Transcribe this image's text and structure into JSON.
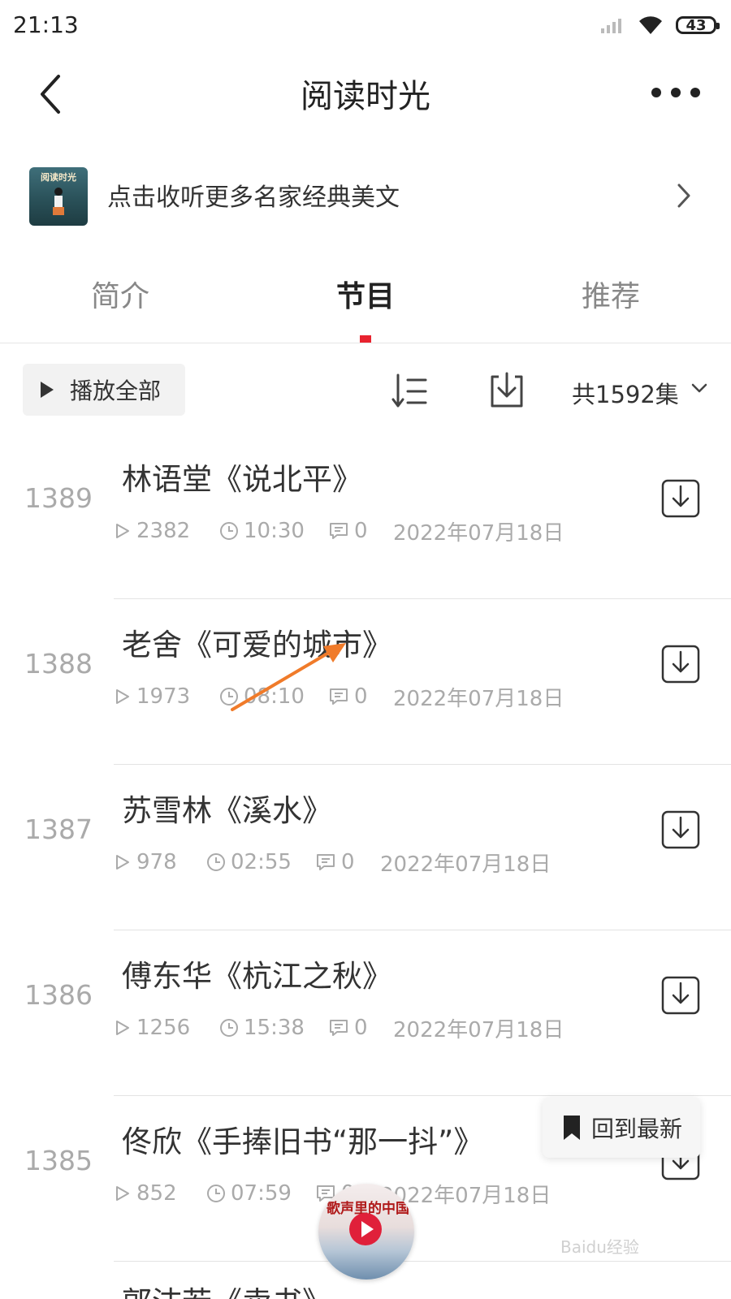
{
  "status_bar": {
    "time": "21:13",
    "battery": "43"
  },
  "header": {
    "title": "阅读时光"
  },
  "banner": {
    "cover_text": "阅读时光",
    "text": "点击收听更多名家经典美文"
  },
  "tabs": [
    {
      "label": "简介"
    },
    {
      "label": "节目"
    },
    {
      "label": "推荐"
    }
  ],
  "toolbar": {
    "play_all": "播放全部",
    "total_count": "共1592集"
  },
  "episodes": [
    {
      "num": "1389",
      "title": "林语堂《说北平》",
      "plays": "2382",
      "duration": "10:30",
      "comments": "0",
      "date": "2022年07月18日"
    },
    {
      "num": "1388",
      "title": "老舍《可爱的城市》",
      "plays": "1973",
      "duration": "08:10",
      "comments": "0",
      "date": "2022年07月18日"
    },
    {
      "num": "1387",
      "title": "苏雪林《溪水》",
      "plays": "978",
      "duration": "02:55",
      "comments": "0",
      "date": "2022年07月18日"
    },
    {
      "num": "1386",
      "title": "傅东华《杭江之秋》",
      "plays": "1256",
      "duration": "15:38",
      "comments": "0",
      "date": "2022年07月18日"
    },
    {
      "num": "1385",
      "title": "佟欣《手捧旧书“那一抖”》",
      "plays": "852",
      "duration": "07:59",
      "comments": "0",
      "date": "2022年07月18日"
    },
    {
      "num": "",
      "title": "郭沫若《卖书》",
      "plays": "",
      "duration": "",
      "comments": "",
      "date": ""
    }
  ],
  "floating": {
    "back_to_latest": "回到最新",
    "player_title": "歌声里的中国"
  },
  "watermark": "Baidu经验",
  "colors": {
    "accent": "#e8232f",
    "arrow": "#f07b2a"
  }
}
